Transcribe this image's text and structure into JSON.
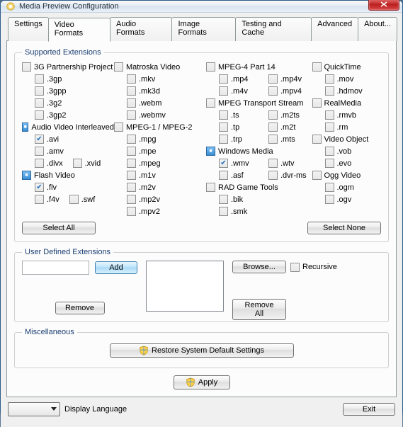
{
  "window": {
    "title": "Media Preview Configuration",
    "close": "✕"
  },
  "tabs": {
    "settings": "Settings",
    "video": "Video Formats",
    "audio": "Audio Formats",
    "image": "Image Formats",
    "testing": "Testing and Cache",
    "advanced": "Advanced",
    "about": "About..."
  },
  "supported": {
    "legend": "Supported Extensions",
    "select_all": "Select All",
    "select_none": "Select None",
    "col1": {
      "g3pp": "3G Partnership Project",
      "e3gp": ".3gp",
      "e3gpp": ".3gpp",
      "e3g2": ".3g2",
      "e3gp2": ".3gp2",
      "avi_group": "Audio Video Interleaved",
      "eavi": ".avi",
      "eamv": ".amv",
      "edivx": ".divx",
      "exvid": ".xvid",
      "flash_group": "Flash Video",
      "eflv": ".flv",
      "ef4v": ".f4v",
      "eswf": ".swf"
    },
    "col2": {
      "matroska": "Matroska Video",
      "emkv": ".mkv",
      "emk3d": ".mk3d",
      "ewebm": ".webm",
      "ewebmv": ".webmv",
      "mpeg12": "MPEG-1 / MPEG-2",
      "empg": ".mpg",
      "empe": ".mpe",
      "empeg": ".mpeg",
      "em1v": ".m1v",
      "em2v": ".m2v",
      "emp2v": ".mp2v",
      "empv2": ".mpv2"
    },
    "col3": {
      "mp4part14": "MPEG-4 Part 14",
      "emp4": ".mp4",
      "emp4v": ".mp4v",
      "em4v": ".m4v",
      "empv4": ".mpv4",
      "mpegts": "MPEG Transport Stream",
      "ets": ".ts",
      "em2ts": ".m2ts",
      "etp": ".tp",
      "em2t": ".m2t",
      "etrp": ".trp",
      "emts": ".mts",
      "winmedia": "Windows Media",
      "ewmv": ".wmv",
      "ewtv": ".wtv",
      "easf": ".asf",
      "edvrms": ".dvr-ms",
      "rad": "RAD Game Tools",
      "ebik": ".bik",
      "esmk": ".smk"
    },
    "col4": {
      "quicktime": "QuickTime",
      "emov": ".mov",
      "ehdmov": ".hdmov",
      "realmedia": "RealMedia",
      "ermvb": ".rmvb",
      "erm": ".rm",
      "videoobj": "Video Object",
      "evob": ".vob",
      "eevo": ".evo",
      "oggv": "Ogg Video",
      "eogm": ".ogm",
      "eogv": ".ogv"
    }
  },
  "ude": {
    "legend": "User Defined Extensions",
    "add": "Add",
    "remove": "Remove",
    "browse": "Browse...",
    "remove_all": "Remove All",
    "recursive": "Recursive"
  },
  "misc": {
    "legend": "Miscellaneous",
    "restore": "Restore System Default Settings",
    "apply": "Apply"
  },
  "footer": {
    "lang_label": "Display Language",
    "exit": "Exit"
  }
}
